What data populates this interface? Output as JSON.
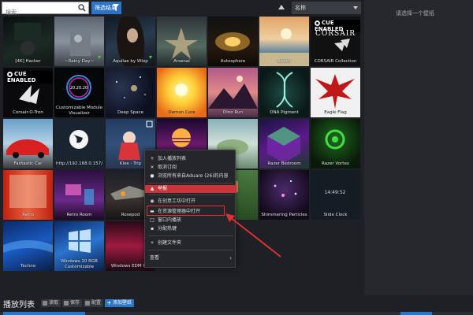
{
  "toolbar": {
    "search_placeholder": "搜索",
    "filter_label": "筛选结果",
    "sort_value": "名称",
    "hint": "请选择一个壁纸"
  },
  "tiles": [
    {
      "label": "[4K] Hacker"
    },
    {
      "label": "~Rainy Day~"
    },
    {
      "label": "Aquilae by Wlop"
    },
    {
      "label": "Arsenal"
    },
    {
      "label": "Autosphere"
    },
    {
      "label": "Beach"
    },
    {
      "label": "CORSAIR Collection"
    },
    {
      "label": "Corsair-O-Tron"
    },
    {
      "label": "Customizable Module Visualizer"
    },
    {
      "label": "Deep Space"
    },
    {
      "label": "Demon Core"
    },
    {
      "label": "Dino Run"
    },
    {
      "label": "DNA Pigment"
    },
    {
      "label": "Eagle Flag"
    },
    {
      "label": "Fantastic Car"
    },
    {
      "label": "http://192.168.0.157/"
    },
    {
      "label": "Klee - Trip"
    },
    {
      "label": ""
    },
    {
      "label": ""
    },
    {
      "label": "Razer Bedroom"
    },
    {
      "label": "Razer Vortex"
    },
    {
      "label": "Retro"
    },
    {
      "label": "Retro Room"
    },
    {
      "label": "Rosepod"
    },
    {
      "label": ""
    },
    {
      "label": ""
    },
    {
      "label": "Shimmering Particles"
    },
    {
      "label": "Slide Clock"
    },
    {
      "label": "Techno"
    },
    {
      "label": "Windows 10 RGB Customizable"
    },
    {
      "label": "Windows EDM R..."
    }
  ],
  "cue_text": "CUE ENABLED",
  "corsair_text": "CORSAIR",
  "clock_text": "14:49:52",
  "visualizer_text": "20.20.20",
  "context_menu": {
    "items": [
      "加入播放列表",
      "取消订阅",
      "浏览所有来自Aduare (26)的内容",
      "举报",
      "在创意工坊中打开",
      "在资源管理器中打开",
      "窗口内播放",
      "分配热键",
      "创建文件夹",
      "查看"
    ]
  },
  "bottom": {
    "title": "播放列表",
    "load": "读取",
    "save": "保存",
    "config": "配置",
    "add": "添加壁纸"
  },
  "colors": {
    "accent": "#2d74c4",
    "danger": "#c8343a",
    "annotation": "#e03030"
  }
}
